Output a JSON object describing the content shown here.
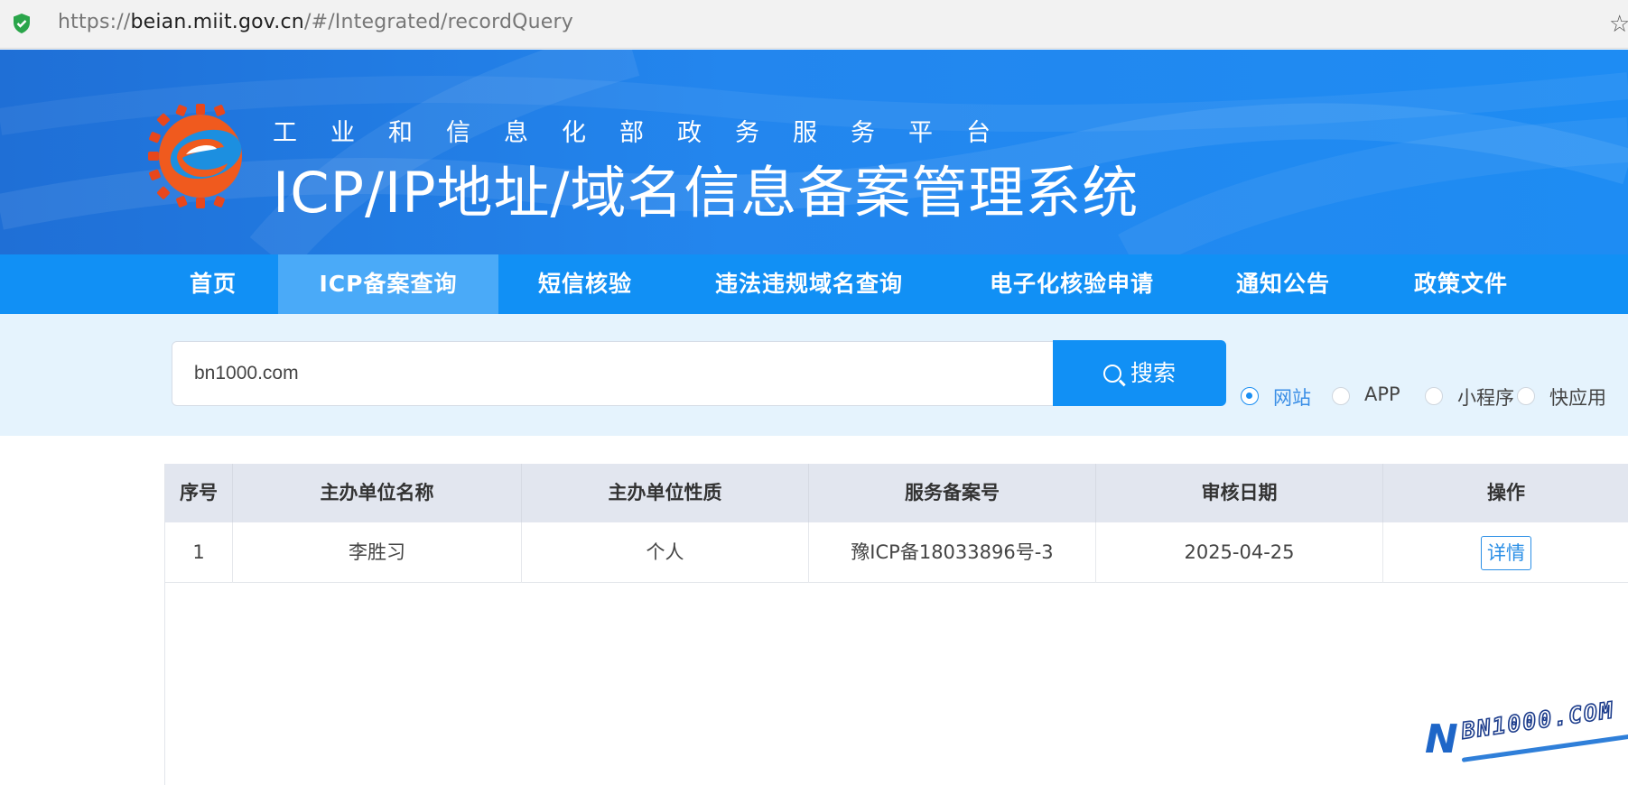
{
  "browser": {
    "url_scheme": "https://",
    "url_host": "beian.miit.gov.cn",
    "url_path": "/#/Integrated/recordQuery"
  },
  "header": {
    "subtitle": "工业和信息化部政务服务平台",
    "title": "ICP/IP地址/域名信息备案管理系统"
  },
  "nav": {
    "items": [
      {
        "label": "首页",
        "active": false
      },
      {
        "label": "ICP备案查询",
        "active": true
      },
      {
        "label": "短信核验",
        "active": false
      },
      {
        "label": "违法违规域名查询",
        "active": false
      },
      {
        "label": "电子化核验申请",
        "active": false
      },
      {
        "label": "通知公告",
        "active": false
      },
      {
        "label": "政策文件",
        "active": false
      }
    ]
  },
  "search": {
    "value": "bn1000.com",
    "button_label": "搜索",
    "types": [
      {
        "label": "网站",
        "checked": true
      },
      {
        "label": "APP",
        "checked": false
      },
      {
        "label": "小程序",
        "checked": false
      },
      {
        "label": "快应用",
        "checked": false
      }
    ]
  },
  "table": {
    "headers": [
      "序号",
      "主办单位名称",
      "主办单位性质",
      "服务备案号",
      "审核日期",
      "操作"
    ],
    "rows": [
      {
        "index": "1",
        "org_name": "李胜习",
        "org_type": "个人",
        "record_no": "豫ICP备18033896号-3",
        "review_date": "2025-04-25",
        "action": "详情"
      }
    ]
  },
  "watermark": {
    "letter": "N",
    "text": "BN1000.COM"
  },
  "colors": {
    "primary": "#1190f5",
    "nav_active": "#4aaaf8",
    "banner": "#2386ee",
    "search_bg": "#e5f3fd",
    "table_header_bg": "#e2e6ef",
    "link": "#2b8fe6"
  },
  "icons": [
    "shield-check-icon",
    "star-icon",
    "search-icon",
    "logo-e-gear-icon"
  ]
}
